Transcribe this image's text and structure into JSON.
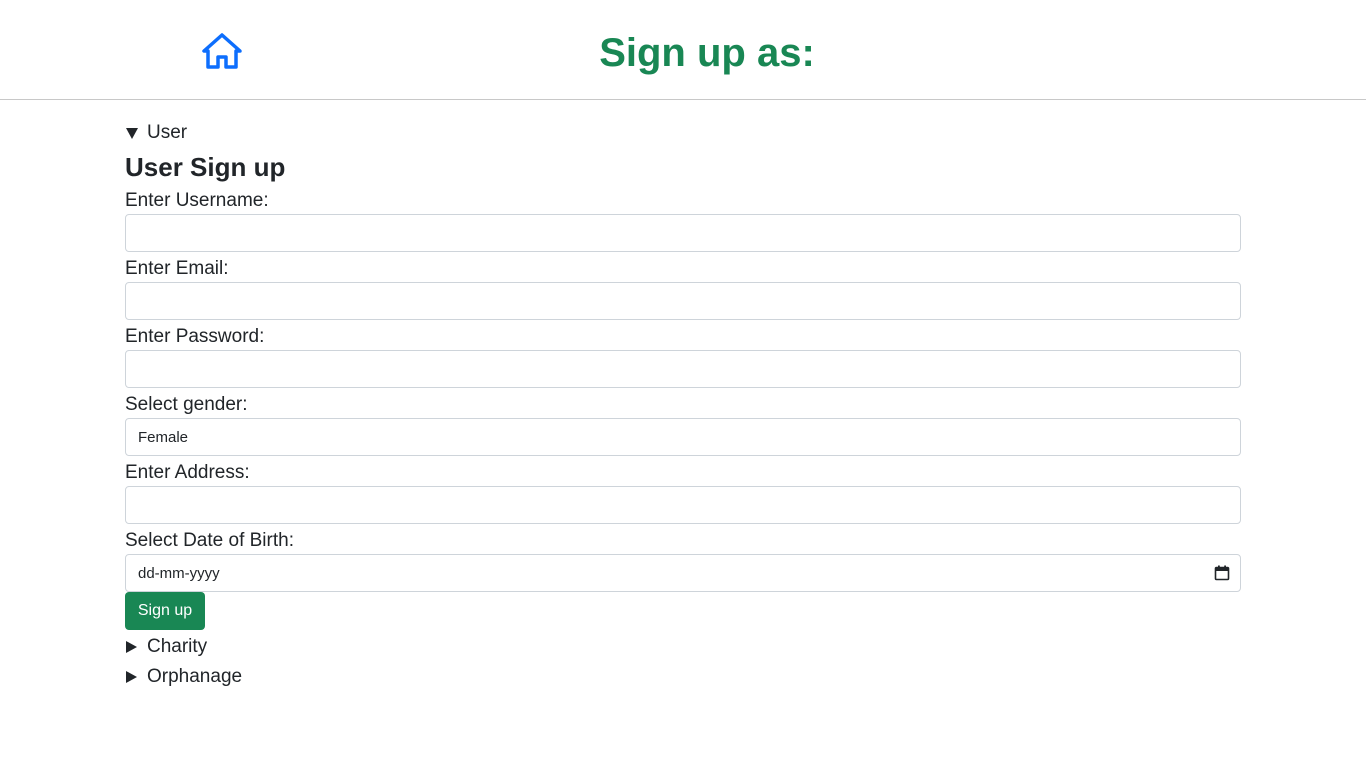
{
  "header": {
    "home_icon": "home-icon",
    "title": "Sign up as:",
    "title_color": "#198754",
    "icon_color": "#0d6efd"
  },
  "user_section": {
    "summary": "User",
    "heading": "User Sign up",
    "fields": {
      "username_label": "Enter Username:",
      "username_value": "",
      "email_label": "Enter Email:",
      "email_value": "",
      "password_label": "Enter Password:",
      "password_value": "",
      "gender_label": "Select gender:",
      "gender_selected": "Female",
      "address_label": "Enter Address:",
      "address_value": "",
      "dob_label": "Select Date of Birth:",
      "dob_placeholder": "dd-mm-yyyy"
    },
    "submit_label": "Sign up",
    "button_color": "#198754"
  },
  "collapsed_sections": {
    "charity": "Charity",
    "orphanage": "Orphanage"
  }
}
